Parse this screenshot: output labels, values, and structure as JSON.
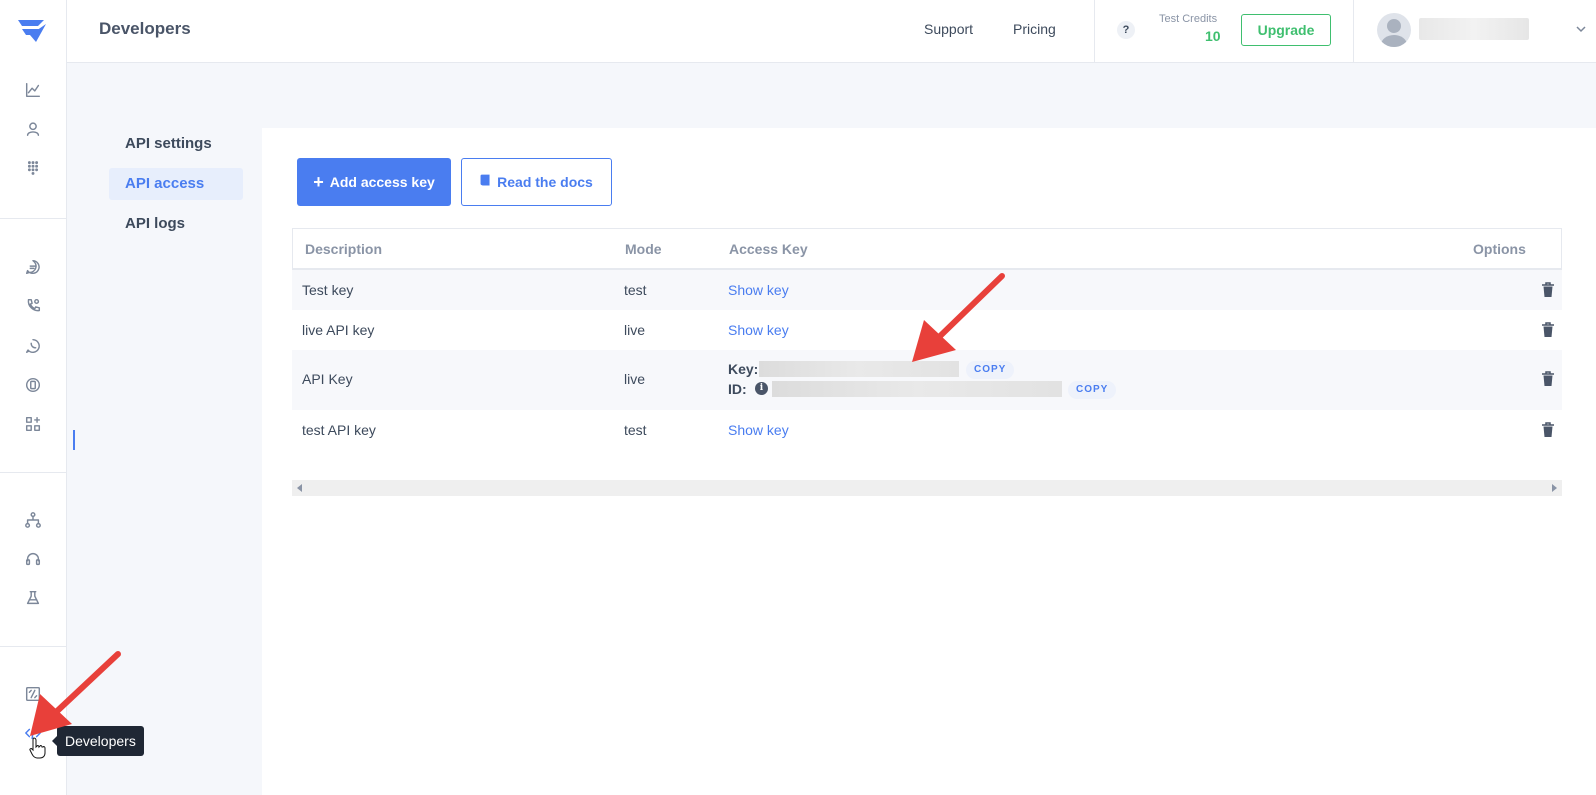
{
  "header": {
    "title": "Developers",
    "support_label": "Support",
    "pricing_label": "Pricing",
    "help_label": "?",
    "credits_label": "Test Credits",
    "credits_value": "10",
    "upgrade_label": "Upgrade"
  },
  "sidebar": {
    "tooltip": "Developers",
    "icons": [
      "logo-icon",
      "chart-line-icon",
      "user-icon",
      "grid-dots-icon",
      "chat-icon",
      "phone-icon",
      "whatsapp-icon",
      "badge-icon",
      "apps-icon",
      "flow-icon",
      "headset-icon",
      "flask-icon",
      "import-export-icon",
      "code-icon"
    ]
  },
  "subnav": {
    "items": [
      "API settings",
      "API access",
      "API logs"
    ],
    "active": "API access"
  },
  "actions": {
    "add_label": "Add access key",
    "docs_label": "Read the docs"
  },
  "table": {
    "headers": [
      "Description",
      "Mode",
      "Access Key",
      "Options"
    ],
    "rows": [
      {
        "description": "Test key",
        "mode": "test",
        "access": "Show key"
      },
      {
        "description": "live API key",
        "mode": "live",
        "access": "Show key"
      },
      {
        "description": "API Key",
        "mode": "live",
        "key_label": "Key:",
        "id_label": "ID:",
        "copy_label": "COPY"
      },
      {
        "description": "test API key",
        "mode": "test",
        "access": "Show key"
      }
    ]
  },
  "colors": {
    "accent": "#4a7df0",
    "success": "#3fbf6f",
    "annotation": "#e8403a"
  }
}
